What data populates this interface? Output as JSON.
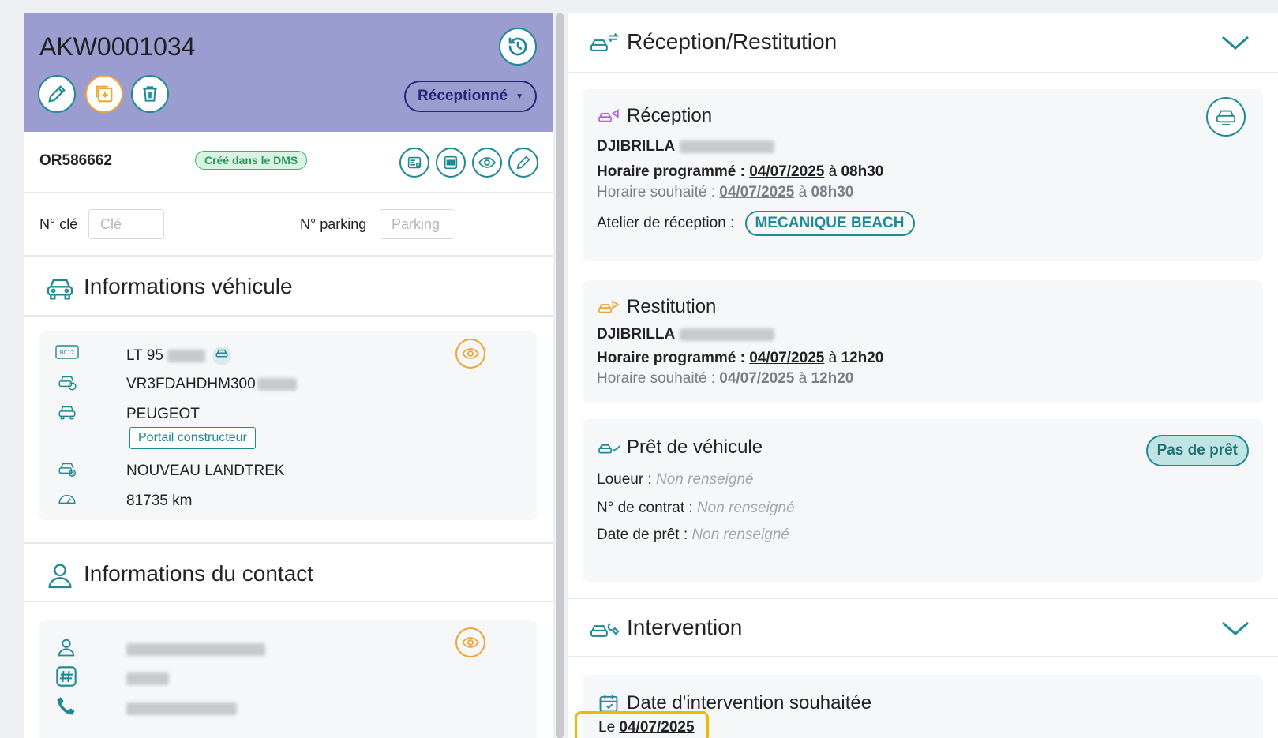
{
  "header": {
    "code": "AKW0001034",
    "status": "Réceptionné"
  },
  "order": {
    "or_number": "OR586662",
    "dms_badge": "Créé dans le DMS"
  },
  "fields": {
    "cle_label": "N° clé",
    "cle_placeholder": "Clé",
    "parking_label": "N° parking",
    "parking_placeholder": "Parking"
  },
  "vehicle": {
    "section_title": "Informations véhicule",
    "plate": "LT 95",
    "vin": "VR3FDAHDHM300",
    "brand": "PEUGEOT",
    "portail": "Portail constructeur",
    "model": "NOUVEAU LANDTREK",
    "mileage": "81735 km"
  },
  "contact": {
    "section_title": "Informations du contact"
  },
  "reception_restitution": {
    "title": "Réception/Restitution",
    "reception": {
      "title": "Réception",
      "name": "DJIBRILLA",
      "prog_label": "Horaire programmé :",
      "prog_date": "04/07/2025",
      "prog_a": "à",
      "prog_time": "08h30",
      "souh_label": "Horaire souhaité :",
      "souh_date": "04/07/2025",
      "souh_a": "à",
      "souh_time": "08h30",
      "atelier_label": "Atelier de réception :",
      "atelier": "MECANIQUE BEACH"
    },
    "restitution": {
      "title": "Restitution",
      "name": "DJIBRILLA",
      "prog_label": "Horaire programmé :",
      "prog_date": "04/07/2025",
      "prog_a": "à",
      "prog_time": "12h20",
      "souh_label": "Horaire souhaité :",
      "souh_date": "04/07/2025",
      "souh_a": "à",
      "souh_time": "12h20"
    },
    "pret": {
      "title": "Prêt de véhicule",
      "badge": "Pas de prêt",
      "loueur_label": "Loueur :",
      "contrat_label": "N° de contrat :",
      "date_label": "Date de prêt :",
      "none": "Non renseigné"
    }
  },
  "intervention": {
    "title": "Intervention",
    "date_title": "Date d'intervention souhaitée",
    "le": "Le",
    "date": "04/07/2025"
  },
  "colors": {
    "header_bg": "#9b9ccf",
    "teal": "#1f8a94",
    "orange": "#f0a438",
    "navy": "#23277a",
    "green": "#3db46d",
    "highlight": "#f0b800"
  }
}
